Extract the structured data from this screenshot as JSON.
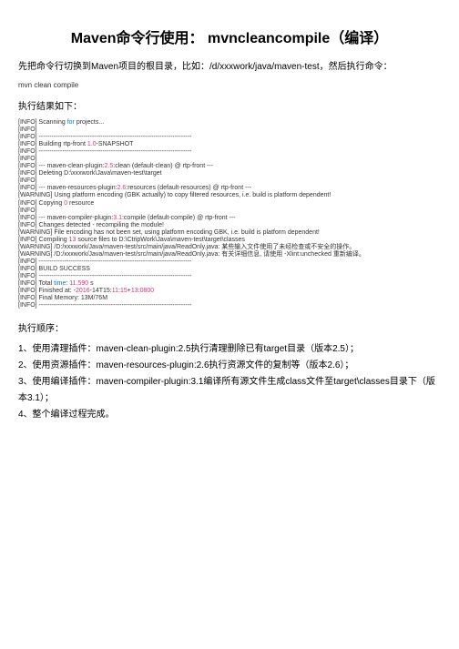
{
  "title": "Maven命令行使用： mvncleancompile（编译）",
  "intro": "先把命令行切换到Maven项目的根目录，比如：/d/xxxwork/java/maven-test，然后执行命令：",
  "cmd": " mvn clean compile",
  "result_label": "执行结果如下：",
  "console_lines": [
    {
      "pre": "[INFO] Scanning ",
      "kw": "for",
      "post": " projects..."
    },
    {
      "pre": "[INFO]",
      "post": ""
    },
    {
      "pre": "[INFO] ------------------------------------------------------------------------",
      "post": ""
    },
    {
      "pre": "[INFO] Building rtp-front ",
      "num": "1.0",
      "post": "-SNAPSHOT"
    },
    {
      "pre": "[INFO] ------------------------------------------------------------------------",
      "post": ""
    },
    {
      "pre": "[INFO]",
      "post": ""
    },
    {
      "pre": "[INFO] --- maven-clean-plugin:",
      "num": "2.5",
      "post": ":clean (default-clean) @ rtp-front ---"
    },
    {
      "pre": "[INFO] Deleting D:\\xxxwork\\Java\\maven-test\\target",
      "post": ""
    },
    {
      "pre": "[INFO]",
      "post": ""
    },
    {
      "pre": "[INFO] --- maven-resources-plugin:",
      "num": "2.6",
      "post": ":resources (default-resources) @ rtp-front ---"
    },
    {
      "pre": "[WARNING] Using platform encoding (GBK actually) to copy filtered resources, i.e. build is platform dependent!",
      "post": ""
    },
    {
      "pre": "[INFO] Copying ",
      "num": "0",
      "post": " resource"
    },
    {
      "pre": "[INFO]",
      "post": ""
    },
    {
      "pre": "[INFO] --- maven-compiler-plugin:",
      "num": "3.1",
      "post": ":compile (default-compile) @ rtp-front ---"
    },
    {
      "pre": "[INFO] Changes detected - recompiling the module!",
      "post": ""
    },
    {
      "pre": "[WARNING] File encoding has not been set, using platform encoding GBK, i.e. build is platform dependent!",
      "post": ""
    },
    {
      "pre": "[INFO] Compiling ",
      "num": "13",
      "post": " source files to D:\\CtripWork\\Java\\maven-test\\target\\classes"
    },
    {
      "pre": "[WARNING] /D:/xxxwork/Java/maven-test/src/main/java/ReadOnly.java: 某些输入文件使用了未经检查或不安全的操作。",
      "post": ""
    },
    {
      "pre": "[WARNING] /D:/xxxwork/Java/maven-test/src/main/java/ReadOnly.java: 有关详细信息, 请使用 -Xlint:unchecked 重新编译。",
      "post": ""
    },
    {
      "pre": "[INFO] ------------------------------------------------------------------------",
      "post": ""
    },
    {
      "pre": "[INFO] BUILD SUCCESS",
      "post": ""
    },
    {
      "pre": "[INFO] ------------------------------------------------------------------------",
      "post": ""
    },
    {
      "pre": "[INFO] Total ",
      "kw": "time",
      "mid": ": ",
      "num": "11.590",
      "post": " s"
    },
    {
      "pre": "[INFO] Finished at: ",
      "num": "2016",
      "mid": "-",
      "num2": "11",
      "mid2": "-14T15:",
      "num3": "15",
      "mid3": ":",
      "num4": "13",
      "mid4": "+",
      "num5": "08",
      "mid5": ":",
      "num6": "00",
      "post": ""
    },
    {
      "pre": "[INFO] Final Memory: 13M/76M",
      "post": ""
    },
    {
      "pre": "[INFO] ------------------------------------------------------------------------",
      "post": ""
    }
  ],
  "order_label": "执行顺序：",
  "steps": [
    "1、使用清理插件：maven-clean-plugin:2.5执行清理删除已有target目录（版本2.5）；",
    "2、使用资源插件：maven-resources-plugin:2.6执行资源文件的复制等（版本2.6）；",
    "3、使用编译插件：maven-compiler-plugin:3.1编译所有源文件生成class文件至target\\classes目录下（版本3.1）；",
    "4、整个编译过程完成。"
  ]
}
